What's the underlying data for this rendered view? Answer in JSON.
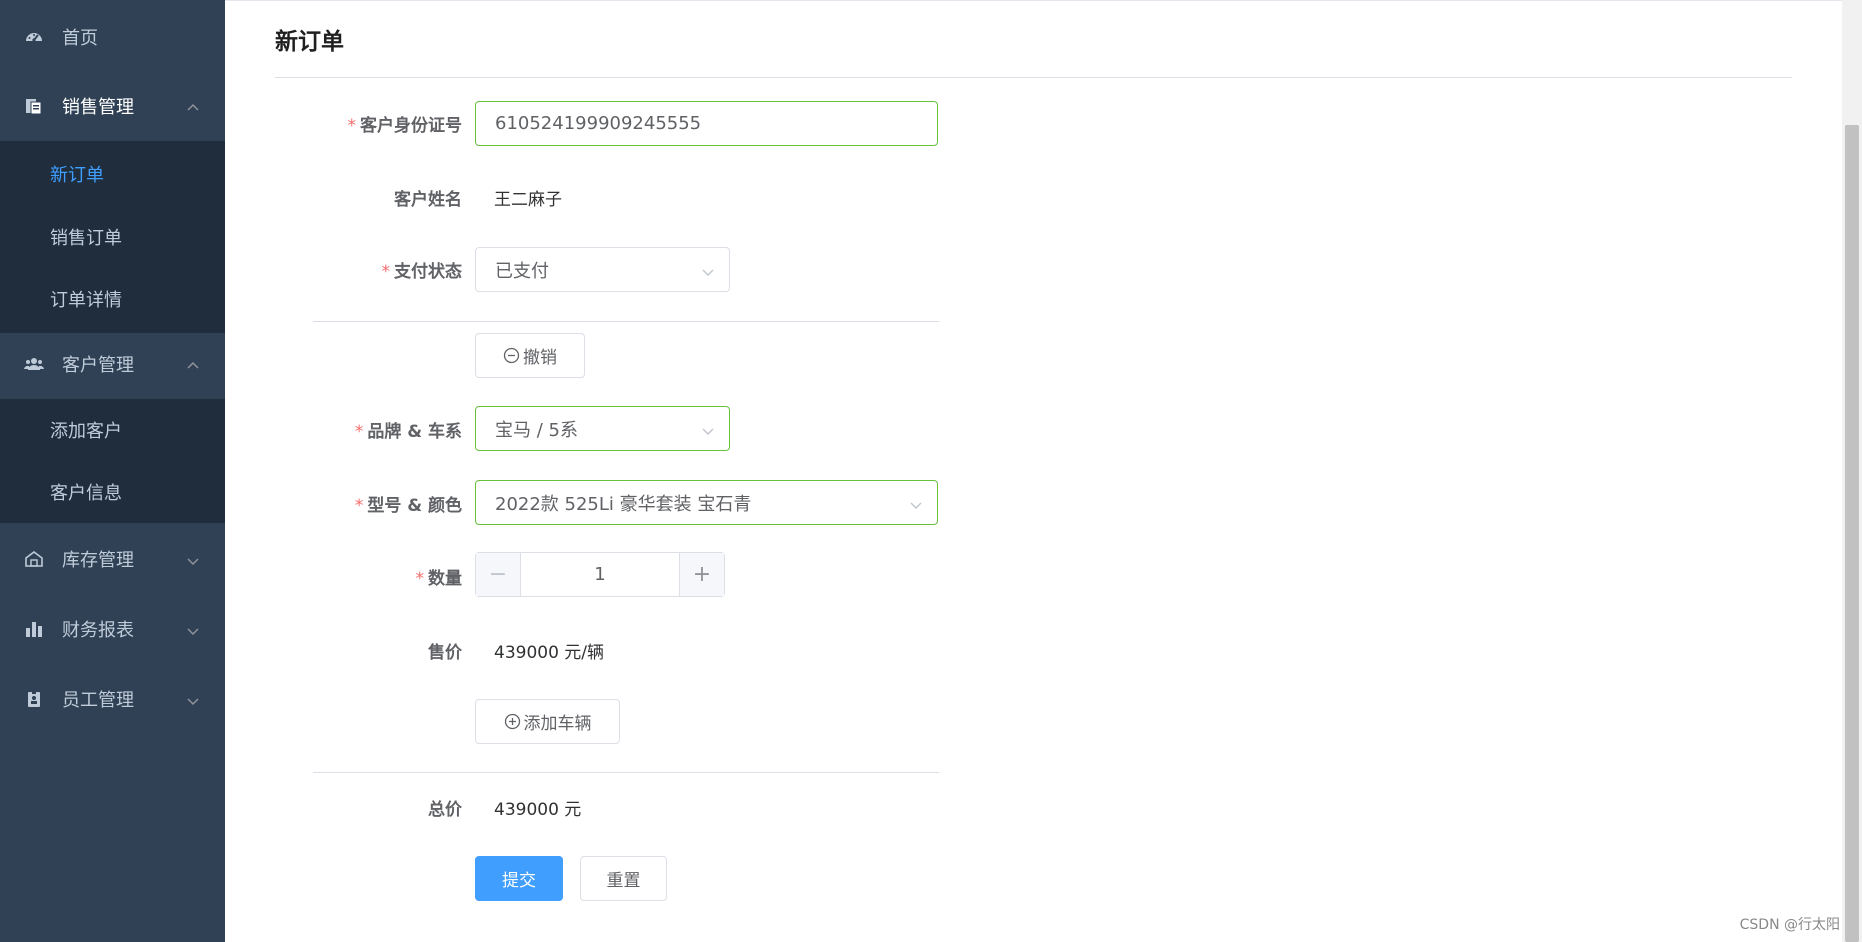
{
  "sidebar": {
    "home": {
      "label": "首页",
      "icon": "dashboard-icon"
    },
    "sales": {
      "label": "销售管理",
      "icon": "document-icon",
      "items": [
        {
          "label": "新订单"
        },
        {
          "label": "销售订单"
        },
        {
          "label": "订单详情"
        }
      ]
    },
    "customers": {
      "label": "客户管理",
      "icon": "people-icon",
      "items": [
        {
          "label": "添加客户"
        },
        {
          "label": "客户信息"
        }
      ]
    },
    "inventory": {
      "label": "库存管理",
      "icon": "warehouse-icon"
    },
    "finance": {
      "label": "财务报表",
      "icon": "bar-chart-icon"
    },
    "staff": {
      "label": "员工管理",
      "icon": "badge-icon"
    }
  },
  "page": {
    "title": "新订单"
  },
  "form": {
    "customer_id": {
      "label": "客户身份证号",
      "value": "610524199909245555"
    },
    "customer_name": {
      "label": "客户姓名",
      "value": "王二麻子"
    },
    "payment_status": {
      "label": "支付状态",
      "value": "已支付"
    },
    "revoke_button": "撤销",
    "brand_series": {
      "label": "品牌 & 车系",
      "value": "宝马 / 5系"
    },
    "model_color": {
      "label": "型号 & 颜色",
      "value": "2022款 525Li 豪华套装 宝石青"
    },
    "quantity": {
      "label": "数量",
      "value": "1",
      "minus": "−",
      "plus": "+"
    },
    "price": {
      "label": "售价",
      "value": "439000 元/辆"
    },
    "add_vehicle_button": "添加车辆",
    "total": {
      "label": "总价",
      "value": "439000 元"
    },
    "submit_button": "提交",
    "reset_button": "重置"
  },
  "required_mark": "*",
  "watermark": "CSDN @行太阳",
  "colors": {
    "sidebar_bg": "#304156",
    "submenu_bg": "#1f2d3d",
    "accent": "#409eff",
    "valid_border": "#67c23a",
    "required": "#f56c6c"
  }
}
